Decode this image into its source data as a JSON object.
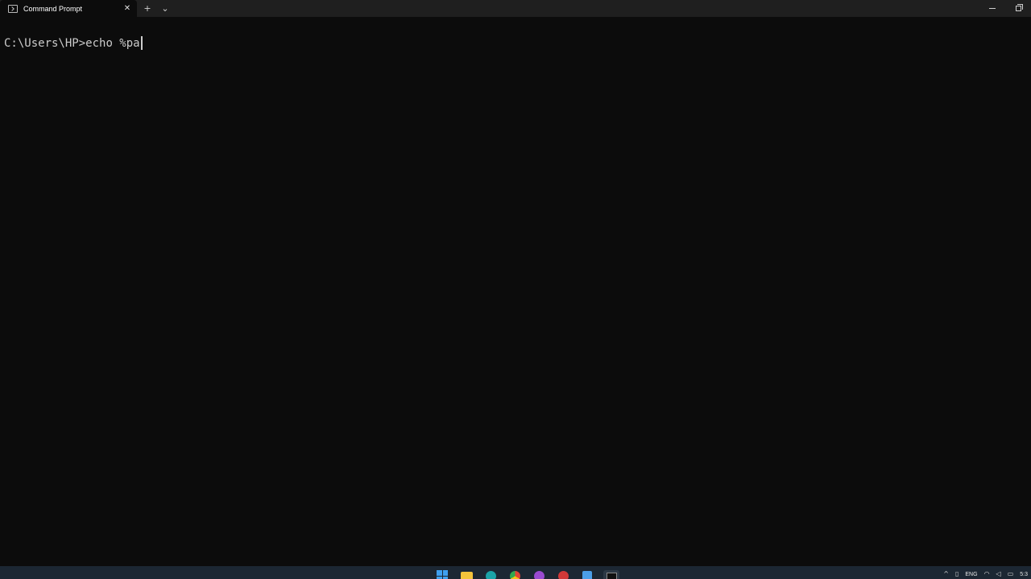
{
  "window": {
    "tab_title": "Command Prompt",
    "tab_close_glyph": "✕",
    "new_tab_glyph": "+",
    "dropdown_glyph": "⌄"
  },
  "terminal": {
    "prompt": "C:\\Users\\HP>",
    "typed_command": "echo %pa",
    "foreground": "#cccccc",
    "background": "#0c0c0c"
  },
  "taskbar": {
    "apps": [
      "start-icon",
      "file-explorer-icon",
      "edge-icon",
      "chrome-icon",
      "app-icon",
      "app-icon",
      "notepad-icon",
      "terminal-icon"
    ],
    "tray": {
      "chevron": "^",
      "language": "ENG",
      "time": "5:3"
    }
  }
}
